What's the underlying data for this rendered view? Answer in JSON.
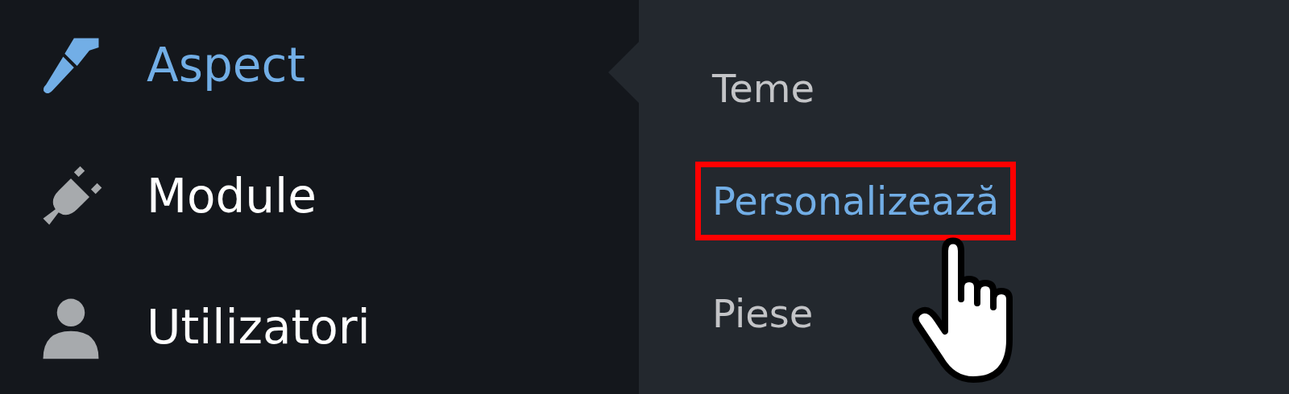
{
  "sidebar": {
    "items": [
      {
        "label": "Aspect",
        "selected": true
      },
      {
        "label": "Module",
        "selected": false
      },
      {
        "label": "Utilizatori",
        "selected": false
      }
    ]
  },
  "submenu": {
    "items": [
      {
        "label": "Teme",
        "selected": false,
        "highlighted": false
      },
      {
        "label": "Personalizează",
        "selected": true,
        "highlighted": true
      },
      {
        "label": "Piese",
        "selected": false,
        "highlighted": false
      }
    ]
  }
}
